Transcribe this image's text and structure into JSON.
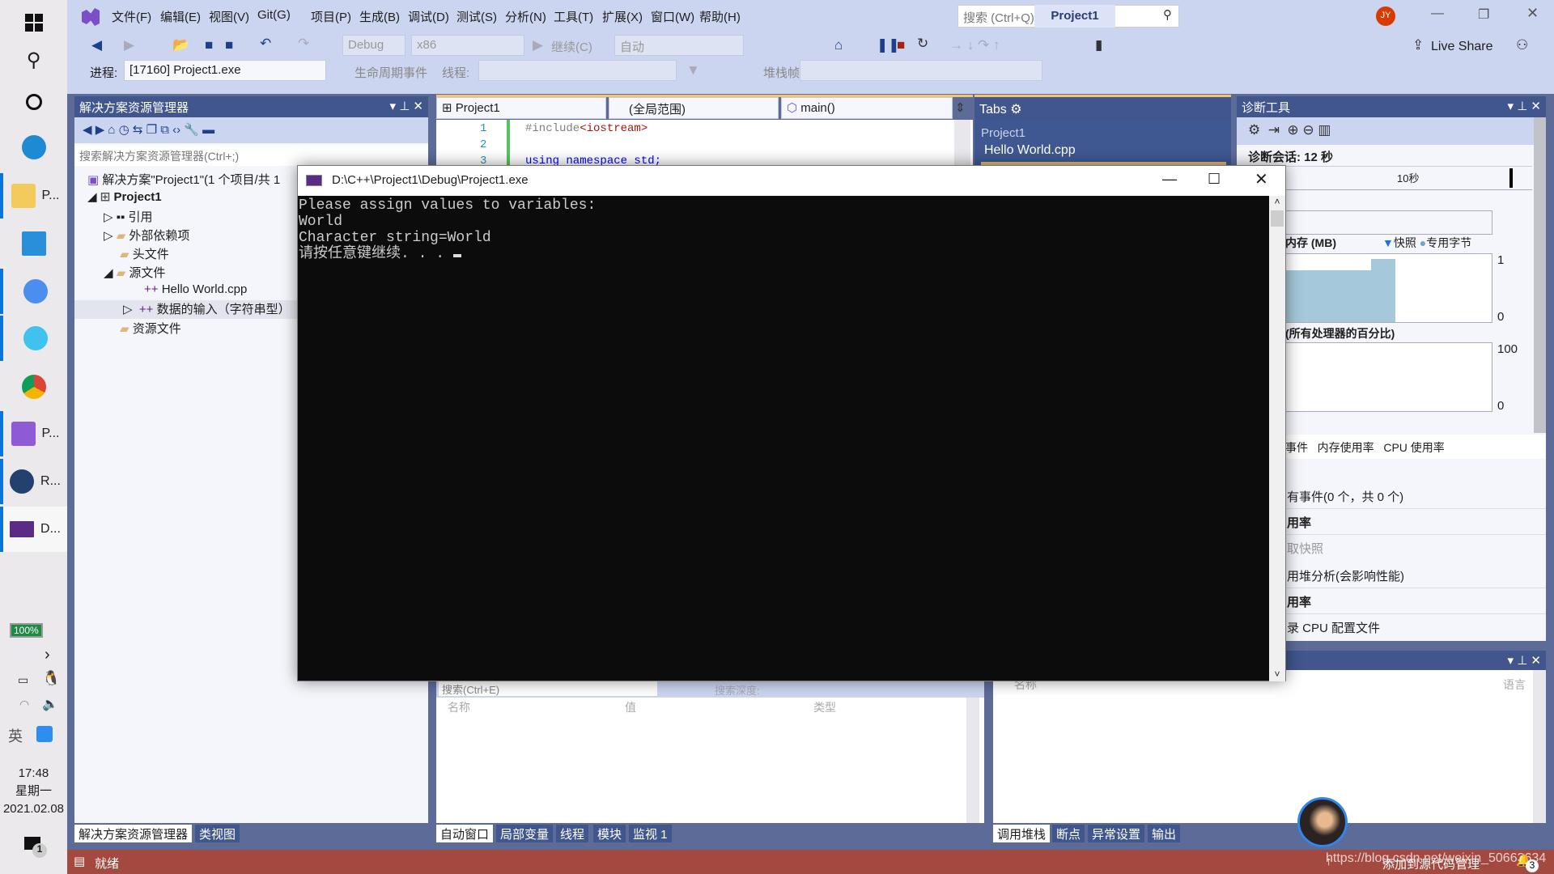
{
  "taskbar": {
    "apps": [
      {
        "label": "P...",
        "icon": "folder-icon"
      },
      {
        "label": "",
        "icon": "mail-icon"
      },
      {
        "label": "",
        "icon": "l-app-icon"
      },
      {
        "label": "",
        "icon": "e-browser-icon"
      },
      {
        "label": "",
        "icon": "chrome-icon"
      },
      {
        "label": "P...",
        "icon": "visual-studio-icon"
      },
      {
        "label": "R...",
        "icon": "avatar-app-icon"
      },
      {
        "label": "D...",
        "icon": "console-icon"
      }
    ],
    "battery": "100%",
    "ime": "英",
    "time": "17:48",
    "weekday": "星期一",
    "date": "2021.02.08",
    "notification_count": "1"
  },
  "menu": [
    "文件(F)",
    "编辑(E)",
    "视图(V)",
    "Git(G)",
    "项目(P)",
    "生成(B)",
    "调试(D)",
    "测试(S)",
    "分析(N)",
    "工具(T)",
    "扩展(X)",
    "窗口(W)",
    "帮助(H)"
  ],
  "search": {
    "placeholder": "搜索 (Ctrl+Q)"
  },
  "title": "Project1",
  "user_initials": "JY",
  "toolbar": {
    "config": "Debug",
    "platform": "x86",
    "continue": "继续(C)",
    "auto": "自动",
    "live_share": "Live Share"
  },
  "debugbar": {
    "process_label": "进程:",
    "process": "[17160] Project1.exe",
    "lifecycle": "生命周期事件",
    "thread_label": "线程:",
    "stackframe_label": "堆栈帧:"
  },
  "solution_explorer": {
    "title": "解决方案资源管理器",
    "search_placeholder": "搜索解决方案资源管理器(Ctrl+;)",
    "items": [
      "解决方案\"Project1\"(1 个项目/共 1",
      "Project1",
      "引用",
      "外部依赖项",
      "头文件",
      "源文件",
      "Hello World.cpp",
      "数据的输入（字符串型）",
      "资源文件"
    ],
    "tabs": [
      "解决方案资源管理器",
      "类视图"
    ]
  },
  "editor": {
    "project_combo": "Project1",
    "scope_combo": "(全局范围)",
    "member_combo": "main()",
    "lines": [
      {
        "num": "1",
        "code_pre": "#include",
        "code_str": "<iostream>"
      },
      {
        "num": "2",
        "code_pre": "",
        "code_str": ""
      },
      {
        "num": "3",
        "code_pre": "using namespace std;",
        "code_str": ""
      }
    ]
  },
  "tabs_panel": {
    "title": "Tabs",
    "group": "Project1",
    "file": "Hello World.cpp"
  },
  "diagnostics": {
    "title": "诊断工具",
    "session": "诊断会话: 12 秒",
    "ruler_label": "10秒",
    "memory_title": "内存 (MB)",
    "legend_snapshot": "快照",
    "legend_private": "专用字节",
    "mem_max": "1",
    "mem_min": "0",
    "cpu_title": "(所有处理器的百分比)",
    "cpu_max": "100",
    "cpu_min": "0",
    "tabs": [
      "事件",
      "内存使用率",
      "CPU 使用率"
    ],
    "rows": [
      "有事件(0 个，共 0 个)",
      "用率",
      "取快照",
      "用堆分析(会影响性能)",
      "用率",
      "录 CPU 配置文件"
    ]
  },
  "console": {
    "title": "D:\\C++\\Project1\\Debug\\Project1.exe",
    "lines": [
      "Please assign values to variables:",
      "World",
      "Character string=World",
      "请按任意键继续. . . "
    ]
  },
  "autos": {
    "search_placeholder": "搜索(Ctrl+E)",
    "depth_label": "搜索深度:",
    "columns": [
      "名称",
      "值",
      "类型"
    ],
    "tabs": [
      "自动窗口",
      "局部变量",
      "线程",
      "模块",
      "监视 1"
    ]
  },
  "callstack": {
    "columns": [
      "名称",
      "语言"
    ],
    "tabs": [
      "调用堆栈",
      "断点",
      "异常设置",
      "输出"
    ]
  },
  "status": {
    "ready": "就绪",
    "source_control": "添加到源代码管理",
    "watermark": "https://blog.csdn.net/weixin_50663634",
    "bell_count": "3"
  },
  "colors": {
    "vs_purple": "#68217a",
    "status_bar": "#a3493f",
    "dock_bg": "#5d6b99",
    "panel_header": "#40568d"
  }
}
